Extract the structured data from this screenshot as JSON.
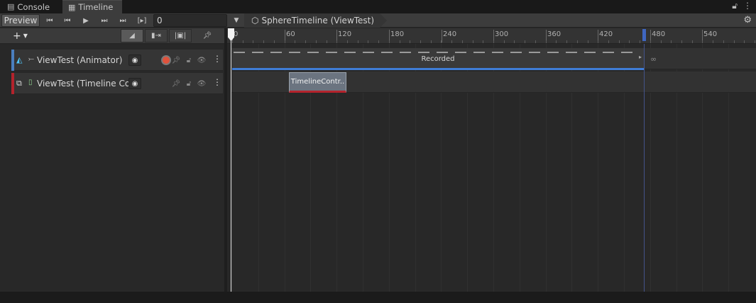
{
  "tabs": [
    {
      "label": "Console",
      "icon": "console-icon"
    },
    {
      "label": "Timeline",
      "icon": "timeline-icon"
    }
  ],
  "toolbar": {
    "preview_label": "Preview",
    "frame_value": "0",
    "breadcrumb_label": "SphereTimeline (ViewTest)"
  },
  "ruler": {
    "ticks": [
      "0",
      "60",
      "120",
      "180",
      "240",
      "300",
      "360",
      "420",
      "480",
      "540"
    ]
  },
  "tracks": [
    {
      "name": "ViewTest (Animator)",
      "type": "animation-track",
      "color": "#4a7fbf"
    },
    {
      "name": "ViewTest (Timeline Controller)",
      "type": "control-track",
      "color": "#b4232c"
    }
  ],
  "clips": {
    "recorded_label": "Recorded",
    "control_clip_label": "TimelineContr.."
  },
  "colors": {
    "accent_blue": "#3f7dd6",
    "record_red": "#e0523c",
    "control_red": "#b4232c"
  }
}
